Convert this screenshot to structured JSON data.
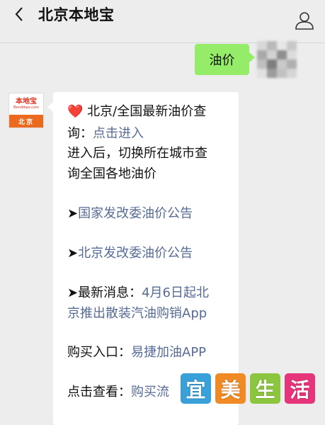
{
  "header": {
    "title": "北京本地宝",
    "back_icon": "chevron-left-icon",
    "profile_icon": "person-icon"
  },
  "sent_message": {
    "text": "油价"
  },
  "bot_avatar": {
    "logo_text": "本地宝",
    "logo_sub": "Bendibao.com",
    "city": "北京"
  },
  "reply": {
    "heart_icon": "heart-icon",
    "line1_text": "北京/全国最新油价查",
    "line2_prefix": "询：",
    "line2_link": "点击进入",
    "line3": "进入后，切换所在城市查",
    "line4": "询全国各地油价",
    "arrow": "➤",
    "national_link": "国家发改委油价公告",
    "beijing_link": "北京发改委油价公告",
    "news_prefix": "最新消息：",
    "news_link_line1": "4月6日起北",
    "news_link_line2": "京推出散装汽油购销App",
    "buy_prefix": "购买入口：",
    "buy_link": "易捷加油APP",
    "view_prefix": "点击查看：",
    "view_link": "购买流"
  },
  "watermark": {
    "chars": [
      "宜",
      "美",
      "生",
      "活"
    ],
    "colors": [
      "#3aa0d8",
      "#f08a24",
      "#8cc63f",
      "#e6357a"
    ]
  },
  "colors": {
    "sent_bubble": "#95ec69",
    "link": "#576b95",
    "background": "#ededed"
  }
}
